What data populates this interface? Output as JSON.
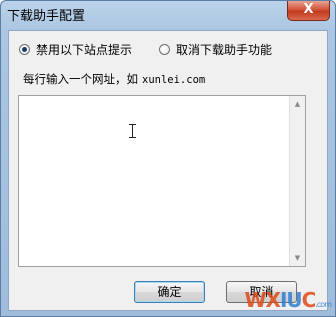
{
  "window": {
    "title": "下载助手配置",
    "close_label": "X"
  },
  "options": {
    "disable_prompt_label": "禁用以下站点提示",
    "disable_prompt_checked": true,
    "cancel_helper_label": "取消下载助手功能",
    "cancel_helper_checked": false
  },
  "hint": {
    "text": "每行输入一个网址，如",
    "example": "xunlei.com"
  },
  "site_list": {
    "value": ""
  },
  "buttons": {
    "ok_label": "确定",
    "cancel_label": "取消"
  },
  "watermark": {
    "text_a": "WX",
    "text_b": "IU",
    "text_c": "C",
    "suffix": ".com"
  },
  "colors": {
    "title_gradient_top": "#bcd3ea",
    "close_button": "#c23a1e",
    "client_bg": "#f0f0f0"
  }
}
